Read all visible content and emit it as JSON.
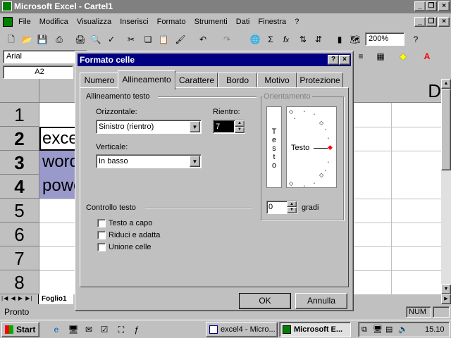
{
  "app": {
    "title": "Microsoft Excel - Cartel1"
  },
  "menu": [
    "File",
    "Modifica",
    "Visualizza",
    "Inserisci",
    "Formato",
    "Strumenti",
    "Dati",
    "Finestra",
    "?"
  ],
  "toolbar": {
    "zoom": "200%"
  },
  "formula": {
    "font": "Arial",
    "cell_ref": "A2"
  },
  "sheet": {
    "col_header_right": "D",
    "rows": [
      "1",
      "2",
      "3",
      "4",
      "5",
      "6",
      "7",
      "8"
    ],
    "cells": {
      "a2": "excel",
      "a3": "word",
      "a4": "power"
    },
    "tab": "Foglio1"
  },
  "dialog": {
    "title": "Formato celle",
    "help": "?",
    "close": "×",
    "tabs": [
      "Numero",
      "Allineamento",
      "Carattere",
      "Bordo",
      "Motivo",
      "Protezione"
    ],
    "active_tab": "Allineamento",
    "section_align": "Allineamento testo",
    "horizontal_label": "Orizzontale:",
    "horizontal_value": "Sinistro (rientro)",
    "indent_label": "Rientro:",
    "indent_value": "7",
    "vertical_label": "Verticale:",
    "vertical_value": "In basso",
    "section_orient": "Orientamento",
    "vertical_text": "Testo",
    "orient_text": "Testo",
    "degrees_value": "0",
    "degrees_label": "gradi",
    "section_control": "Controllo testo",
    "checkboxes": [
      "Testo a capo",
      "Riduci e adatta",
      "Unione celle"
    ],
    "ok": "OK",
    "cancel": "Annulla"
  },
  "status": {
    "left": "Pronto",
    "num": "NUM"
  },
  "taskbar": {
    "start": "Start",
    "items": [
      "excel4 - Micro...",
      "Microsoft E..."
    ],
    "clock": "15.10"
  }
}
